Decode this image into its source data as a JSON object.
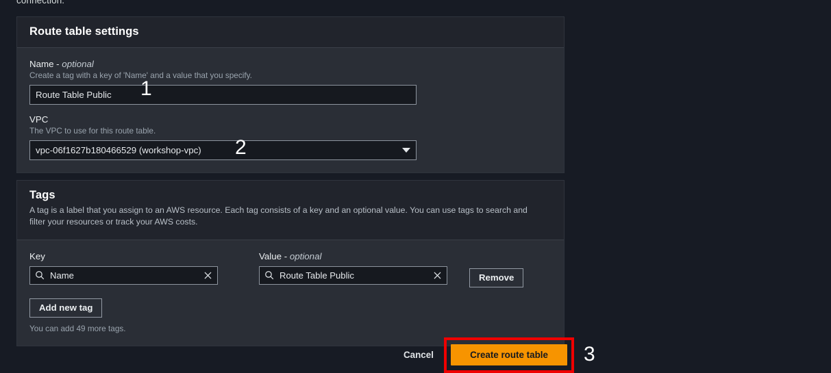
{
  "page": {
    "cutoff_text": "connection.",
    "background_color": "#171b24"
  },
  "route_table_settings": {
    "title": "Route table settings",
    "name_field": {
      "label": "Name - ",
      "label_optional": "optional",
      "hint": "Create a tag with a key of 'Name' and a value that you specify.",
      "value": "Route Table Public",
      "placeholder": ""
    },
    "vpc_field": {
      "label": "VPC",
      "hint": "The VPC to use for this route table.",
      "selected": "vpc-06f1627b180466529 (workshop-vpc)",
      "caret_icon": "chevron-down-icon"
    }
  },
  "tags": {
    "title": "Tags",
    "description": "A tag is a label that you assign to an AWS resource. Each tag consists of a key and an optional value. You can use tags to search and filter your resources or track your AWS costs.",
    "key_column_label": "Key",
    "value_column_label": "Value - ",
    "value_column_label_optional": "optional",
    "rows": [
      {
        "key": "Name",
        "value": "Route Table Public",
        "key_search_icon": "search-icon",
        "key_clear_icon": "close-icon",
        "value_search_icon": "search-icon",
        "value_clear_icon": "close-icon",
        "remove_label": "Remove"
      }
    ],
    "add_new_tag_label": "Add new tag",
    "more_tags_text": "You can add 49 more tags."
  },
  "footer": {
    "cancel_label": "Cancel",
    "create_label": "Create route table",
    "primary_color": "#f79400",
    "highlight_color": "#ef0000"
  },
  "annotations": [
    {
      "label": "1"
    },
    {
      "label": "2"
    },
    {
      "label": "3"
    }
  ]
}
